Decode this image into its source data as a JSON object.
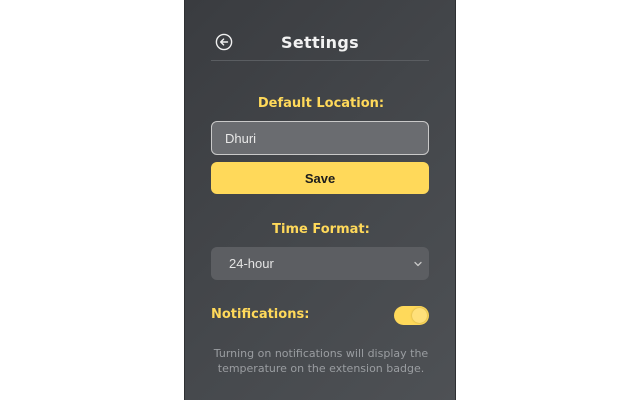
{
  "header": {
    "title": "Settings",
    "back_icon": "arrow-left-circle-icon"
  },
  "location": {
    "label": "Default Location:",
    "value": "Dhuri",
    "save_label": "Save"
  },
  "time_format": {
    "label": "Time Format:",
    "selected": "24-hour",
    "chevron_icon": "chevron-down-icon"
  },
  "notifications": {
    "label": "Notifications:",
    "enabled": true,
    "note": "Turning on notifications will display the temperature on the extension badge."
  },
  "colors": {
    "accent": "#ffd95a",
    "panel_background": "#45484c",
    "text_primary": "#f2f2f2",
    "text_muted": "#9a9da1"
  }
}
